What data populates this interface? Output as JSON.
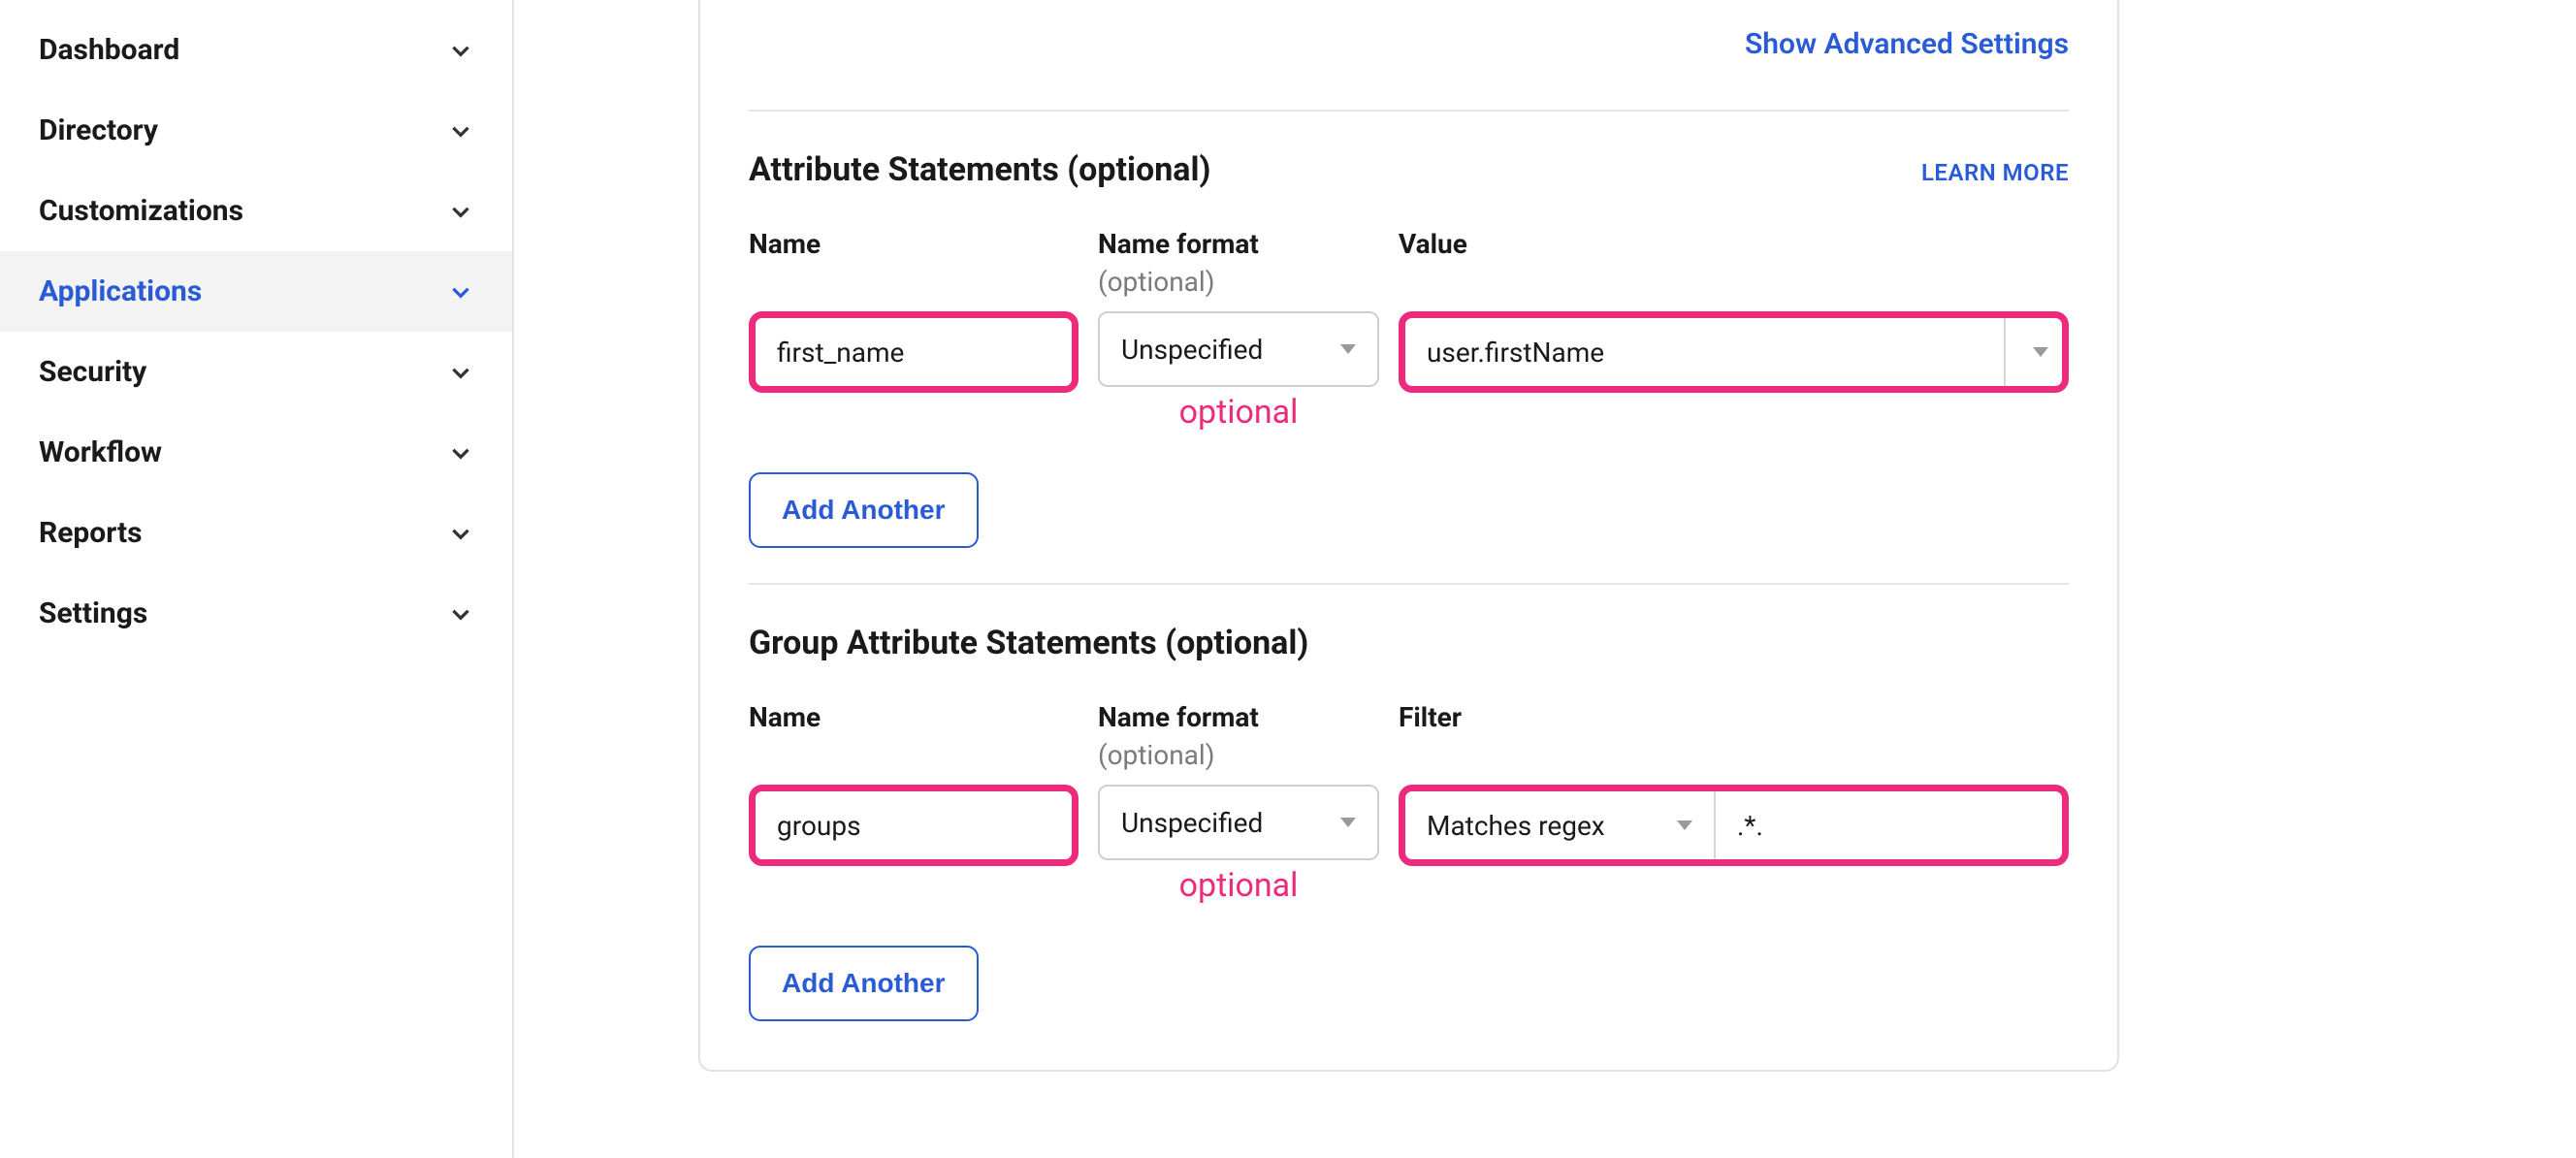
{
  "sidebar": {
    "items": [
      {
        "label": "Dashboard"
      },
      {
        "label": "Directory"
      },
      {
        "label": "Customizations"
      },
      {
        "label": "Applications"
      },
      {
        "label": "Security"
      },
      {
        "label": "Workflow"
      },
      {
        "label": "Reports"
      },
      {
        "label": "Settings"
      }
    ]
  },
  "panel": {
    "show_advanced": "Show Advanced Settings",
    "attr": {
      "title": "Attribute Statements (optional)",
      "learn_more": "LEARN MORE",
      "head_name": "Name",
      "head_format": "Name format",
      "head_format_sub": "(optional)",
      "head_value": "Value",
      "row": {
        "name": "first_name",
        "format": "Unspecified",
        "value": "user.firstName"
      },
      "annot": "optional",
      "add": "Add Another"
    },
    "group": {
      "title": "Group Attribute Statements (optional)",
      "head_name": "Name",
      "head_format": "Name format",
      "head_format_sub": "(optional)",
      "head_filter": "Filter",
      "row": {
        "name": "groups",
        "format": "Unspecified",
        "filter_type": "Matches regex",
        "filter_value": ".*."
      },
      "annot": "optional",
      "add": "Add Another"
    }
  }
}
